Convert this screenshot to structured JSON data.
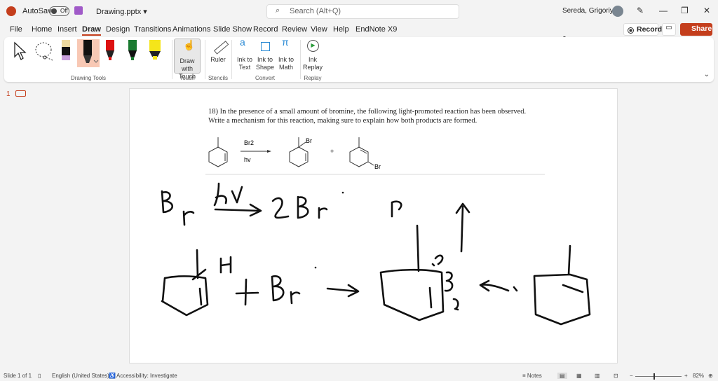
{
  "titlebar": {
    "autosave": "AutoSave",
    "autosave_state": "Off",
    "filename": "Drawing.pptx",
    "search_placeholder": "Search (Alt+Q)",
    "user": "Sereda, Grigoriy A"
  },
  "menu": [
    "File",
    "Home",
    "Insert",
    "Draw",
    "Design",
    "Transitions",
    "Animations",
    "Slide Show",
    "Record",
    "Review",
    "View",
    "Help",
    "EndNote X9"
  ],
  "actions": {
    "record": "Record",
    "share": "Share"
  },
  "ribbon": {
    "draw_with_touch": "Draw with Touch",
    "ruler": "Ruler",
    "ink_to_text": "Ink to Text",
    "ink_to_shape": "Ink to Shape",
    "ink_to_math": "Ink to Math",
    "ink_replay": "Ink Replay",
    "groups": {
      "drawing_tools": "Drawing Tools",
      "touch": "Touch",
      "stencils": "Stencils",
      "convert": "Convert",
      "replay": "Replay"
    }
  },
  "thumbnails": {
    "slide_number": "1"
  },
  "slide": {
    "question_line1": "18) In the presence of a small amount of bromine, the following light-promoted reaction has been observed.",
    "question_line2": "Write a mechanism for this reaction, making sure to explain how both products are formed.",
    "reagent": "Br2",
    "condition": "hv",
    "br_label_1": "Br",
    "br_label_2": "Br",
    "plus": "+"
  },
  "status": {
    "slide": "Slide 1 of 1",
    "language": "English (United States)",
    "accessibility": "Accessibility: Investigate",
    "notes": "Notes",
    "zoom": "82%"
  },
  "colors": {
    "accent": "#c43e1c",
    "selected_pen_bg": "#f8c8b4"
  }
}
